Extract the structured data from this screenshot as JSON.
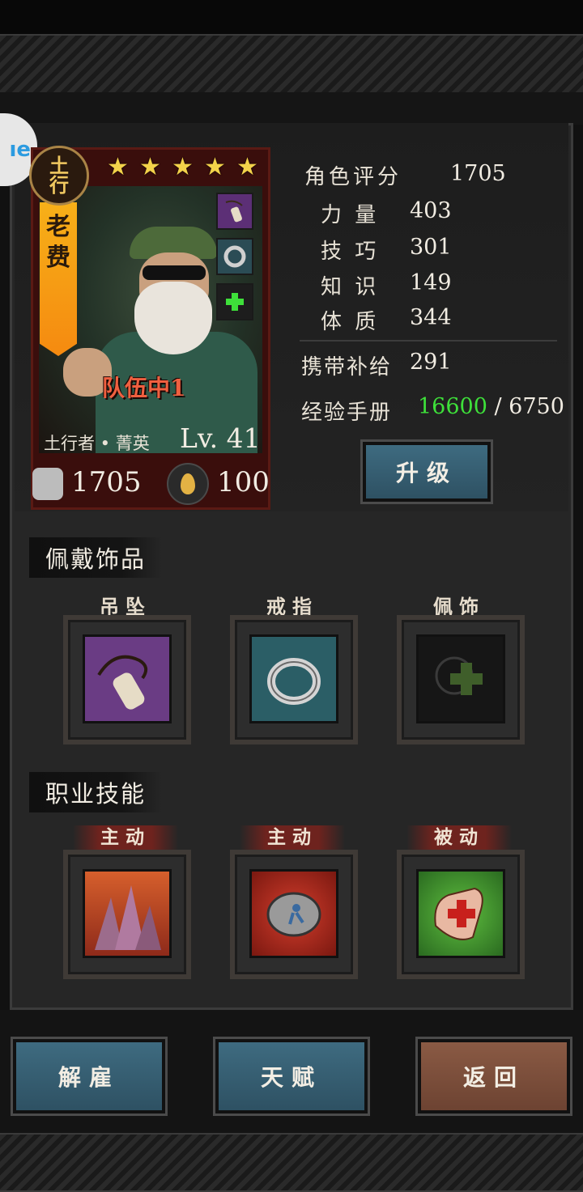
{
  "hero": {
    "element": [
      "土",
      "行"
    ],
    "name_chars": [
      "老",
      "费"
    ],
    "stars": 5,
    "team_label": "队伍中1",
    "class_rank": "土行者 • 菁英",
    "level": "Lv. 41",
    "power": "1705",
    "drop_value": "100"
  },
  "stats": {
    "rating_label": "角色评分",
    "rating_value": "1705",
    "strength_label": "力 量",
    "strength_value": "403",
    "skill_label": "技 巧",
    "skill_value": "301",
    "knowledge_label": "知 识",
    "knowledge_value": "149",
    "physique_label": "体 质",
    "physique_value": "344",
    "supply_label": "携带补给",
    "supply_value": "291",
    "exp_label": "经验手册",
    "exp_current": "16600",
    "exp_sep": " / ",
    "exp_total": "6750",
    "upgrade_label": "升级"
  },
  "accessories": {
    "title": "佩戴饰品",
    "slots": [
      {
        "label": "吊坠",
        "icon": "pendant-icon"
      },
      {
        "label": "戒指",
        "icon": "ring-icon"
      },
      {
        "label": "佩饰",
        "icon": "ornament-empty-icon"
      }
    ]
  },
  "skills": {
    "title": "职业技能",
    "slots": [
      {
        "tag": "主动",
        "icon": "earth-spikes-icon"
      },
      {
        "tag": "主动",
        "icon": "rock-throw-icon"
      },
      {
        "tag": "被动",
        "icon": "healing-hand-icon"
      }
    ]
  },
  "buttons": {
    "dismiss": "解雇",
    "talent": "天赋",
    "back": "返回"
  },
  "corner_tab": "ıe",
  "colors": {
    "exp_green": "#3ee03a",
    "team_red": "#f06040",
    "banner_orange": "#f58a10",
    "button_blue": "#2e5163",
    "button_brown": "#6d4332"
  }
}
